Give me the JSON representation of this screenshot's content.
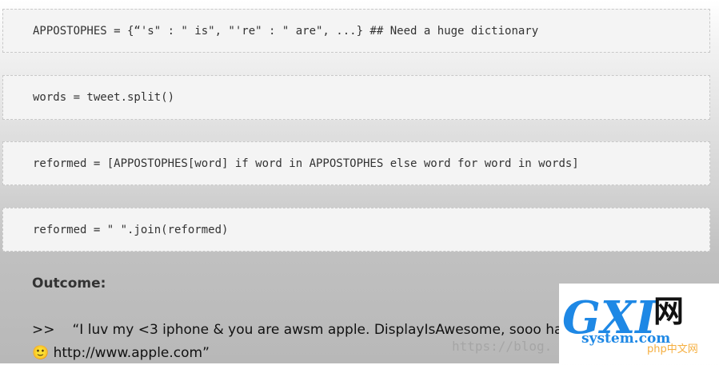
{
  "code_lines": [
    "APPOSTOPHES = {“'s\" : \" is\", \"'re\" : \" are\", ...} ## Need a huge dictionary",
    "words = tweet.split()",
    "reformed = [APPOSTOPHES[word] if word in APPOSTOPHES else word for word in words]",
    "reformed = \" \".join(reformed)"
  ],
  "outcome": {
    "label": "Outcome:",
    "prompt": ">>",
    "text": "“I luv my <3 iphone & you are awsm apple. DisplayIsAwesome, sooo happppppy 🙂 http://www.apple.com”"
  },
  "watermark": {
    "url_fragment": "https://blog.",
    "logo_letters": "GXI",
    "logo_cjk": "网",
    "logo_domain": "system.com",
    "logo_small": "php中文网"
  },
  "colors": {
    "code_bg": "#f4f4f4",
    "logo_orange": "#f39c12",
    "logo_blue": "#1e88e5"
  }
}
